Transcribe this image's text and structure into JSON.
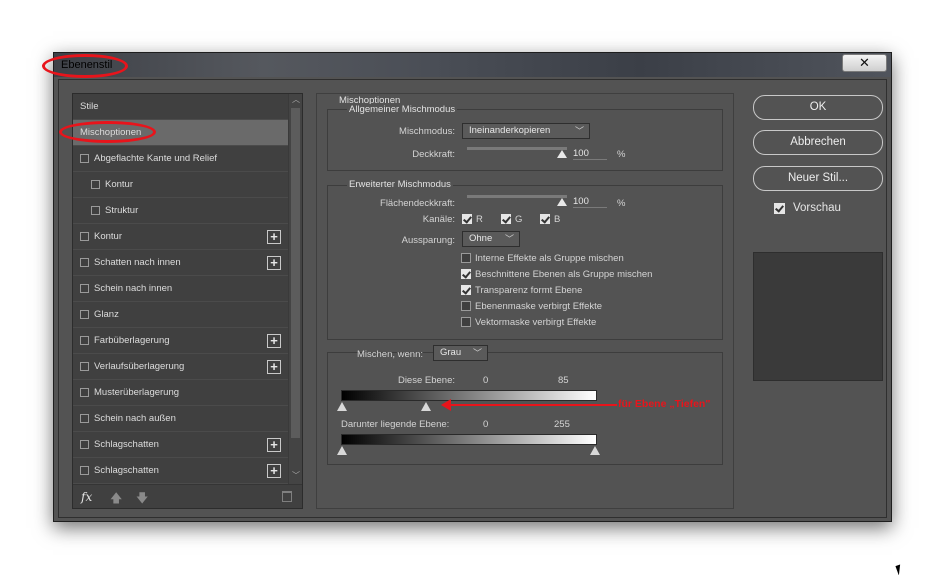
{
  "window": {
    "title": "Ebenenstil",
    "close_glyph": "✕"
  },
  "styles_panel": {
    "items": [
      {
        "label": "Stile",
        "checkbox": false,
        "plus": false,
        "indent": 0,
        "selected": false
      },
      {
        "label": "Mischoptionen",
        "checkbox": false,
        "plus": false,
        "indent": 0,
        "selected": true
      },
      {
        "label": "Abgeflachte Kante und Relief",
        "checkbox": true,
        "plus": false,
        "indent": 0,
        "selected": false
      },
      {
        "label": "Kontur",
        "checkbox": true,
        "plus": false,
        "indent": 1,
        "selected": false
      },
      {
        "label": "Struktur",
        "checkbox": true,
        "plus": false,
        "indent": 1,
        "selected": false
      },
      {
        "label": "Kontur",
        "checkbox": true,
        "plus": true,
        "indent": 0,
        "selected": false
      },
      {
        "label": "Schatten nach innen",
        "checkbox": true,
        "plus": true,
        "indent": 0,
        "selected": false
      },
      {
        "label": "Schein nach innen",
        "checkbox": true,
        "plus": false,
        "indent": 0,
        "selected": false
      },
      {
        "label": "Glanz",
        "checkbox": true,
        "plus": false,
        "indent": 0,
        "selected": false
      },
      {
        "label": "Farbüberlagerung",
        "checkbox": true,
        "plus": true,
        "indent": 0,
        "selected": false
      },
      {
        "label": "Verlaufsüberlagerung",
        "checkbox": true,
        "plus": true,
        "indent": 0,
        "selected": false
      },
      {
        "label": "Musterüberlagerung",
        "checkbox": true,
        "plus": false,
        "indent": 0,
        "selected": false
      },
      {
        "label": "Schein nach außen",
        "checkbox": true,
        "plus": false,
        "indent": 0,
        "selected": false
      },
      {
        "label": "Schlagschatten",
        "checkbox": true,
        "plus": true,
        "indent": 0,
        "selected": false
      },
      {
        "label": "Schlagschatten",
        "checkbox": true,
        "plus": true,
        "indent": 0,
        "selected": false
      }
    ],
    "footer": {
      "fx_label": "fx",
      "fx_icon": "fx-icon",
      "up_icon": "arrow-up-icon",
      "down_icon": "arrow-down-icon",
      "trash_icon": "trash-icon"
    }
  },
  "blending_options": {
    "title": "Mischoptionen",
    "general": {
      "title": "Allgemeiner Mischmodus",
      "blend_mode_label": "Mischmodus:",
      "blend_mode_value": "Ineinanderkopieren",
      "opacity_label": "Deckkraft:",
      "opacity_value": "100",
      "opacity_unit": "%"
    },
    "advanced": {
      "title": "Erweiterter Mischmodus",
      "fill_opacity_label": "Flächendeckkraft:",
      "fill_opacity_value": "100",
      "fill_opacity_unit": "%",
      "channels_label": "Kanäle:",
      "channels": [
        {
          "label": "R",
          "checked": true
        },
        {
          "label": "G",
          "checked": true
        },
        {
          "label": "B",
          "checked": true
        }
      ],
      "knockout_label": "Aussparung:",
      "knockout_value": "Ohne",
      "options": [
        {
          "label": "Interne Effekte als Gruppe mischen",
          "checked": false
        },
        {
          "label": "Beschnittene Ebenen als Gruppe mischen",
          "checked": true
        },
        {
          "label": "Transparenz formt Ebene",
          "checked": true
        },
        {
          "label": "Ebenenmaske verbirgt Effekte",
          "checked": false
        },
        {
          "label": "Vektormaske verbirgt Effekte",
          "checked": false
        }
      ]
    },
    "blend_if": {
      "label": "Mischen, wenn:",
      "value": "Grau",
      "this_layer_label": "Diese Ebene:",
      "this_layer_low": "0",
      "this_layer_high": "85",
      "underlying_label": "Darunter liegende Ebene:",
      "underlying_low": "0",
      "underlying_high": "255"
    }
  },
  "buttons": {
    "ok": "OK",
    "cancel": "Abbrechen",
    "new_style": "Neuer Stil...",
    "preview_label": "Vorschau",
    "preview_checked": true
  },
  "annotation": {
    "text": "für Ebene „Tiefen\""
  },
  "colors": {
    "dialog_bg": "#535353",
    "panel_bg": "#404040",
    "accent_red": "#e8141b"
  }
}
